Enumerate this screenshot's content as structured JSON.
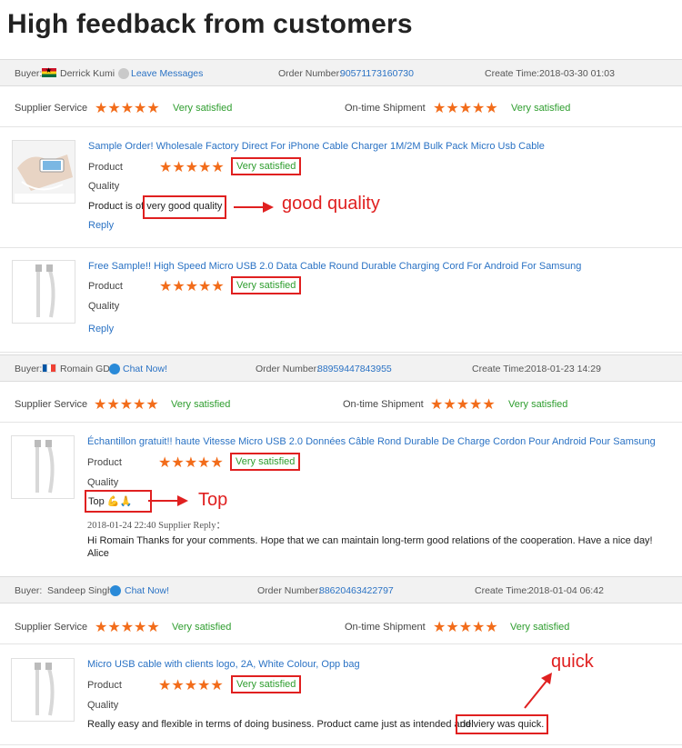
{
  "page_title": "High feedback from customers",
  "labels": {
    "buyer": "Buyer:",
    "order_number": "Order Number:",
    "create_time": "Create Time:",
    "supplier_service": "Supplier Service",
    "ontime_shipment": "On-time Shipment",
    "product": "Product",
    "quality": "Quality",
    "reply": "Reply",
    "very_satisfied": "Very satisfied",
    "stars": "★★★★★"
  },
  "colors": {
    "accent_link": "#2a72c4",
    "star": "#f26c1a",
    "satisfied": "#2e9d2e",
    "annotation": "#e02020"
  },
  "orders": [
    {
      "buyer_name": "Derrick Kumi",
      "buyer_flag": "ghana-flag-icon",
      "action_label": "Leave Messages",
      "order_number": "90571173160730",
      "create_time": "2018-03-30 01:03",
      "products": [
        {
          "title": "Sample Order! Wholesale Factory Direct For iPhone Cable Charger 1M/2M Bulk Pack Micro Usb Cable",
          "comment": "Product is of very good quality",
          "annotation": "good quality"
        },
        {
          "title": "Free Sample!! High Speed Micro USB 2.0 Data Cable Round Durable Charging Cord For Android For Samsung"
        }
      ]
    },
    {
      "buyer_name": "Romain GD",
      "buyer_flag": "france-flag-icon",
      "action_label": "Chat Now!",
      "order_number": "88959447843955",
      "create_time": "2018-01-23 14:29",
      "products": [
        {
          "title": "Échantillon gratuit!! haute Vitesse Micro USB 2.0 Données Câble Rond Durable De Charge Cordon Pour Android Pour Samsung",
          "comment": "Top 💪🙏",
          "annotation": "Top",
          "supplier_reply_meta": "2018-01-24 22:40  Supplier Reply：",
          "supplier_reply_line1": "Hi Romain Thanks for your comments. Hope that we can maintain long-term good relations of the cooperation. Have a nice day!",
          "supplier_reply_line2": "Alice"
        }
      ]
    },
    {
      "buyer_name": "Sandeep Singh",
      "action_label": "Chat Now!",
      "order_number": "88620463422797",
      "create_time": "2018-01-04 06:42",
      "products": [
        {
          "title": "Micro USB cable with clients logo, 2A, White Colour, Opp bag",
          "comment_part1": "Really easy and flexible in terms of doing business. Product came just as intended and ",
          "comment_part2": "delviery was quick.",
          "annotation": "quick"
        }
      ]
    }
  ]
}
